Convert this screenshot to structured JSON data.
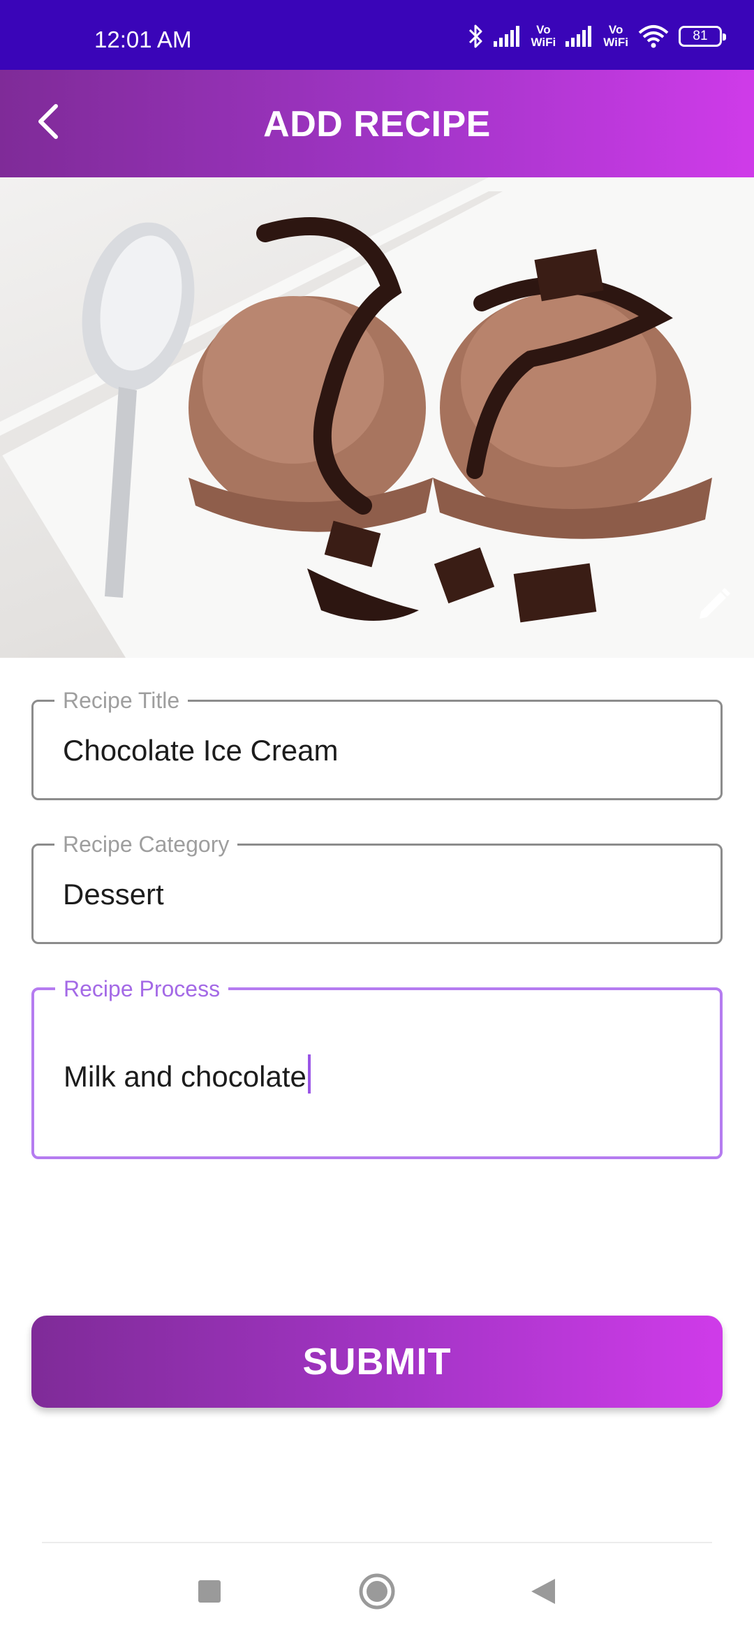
{
  "status_bar": {
    "time": "12:01 AM",
    "vowifi_1": "Vo WiFi",
    "vowifi_2": "Vo WiFi",
    "battery": "81"
  },
  "app_bar": {
    "title": "ADD RECIPE"
  },
  "form": {
    "title_label": "Recipe Title",
    "title_value": "Chocolate Ice Cream",
    "category_label": "Recipe Category",
    "category_value": "Dessert",
    "process_label": "Recipe Process",
    "process_value": "Milk and chocolate"
  },
  "submit": {
    "label": "SUBMIT"
  },
  "colors": {
    "status_bar": "#3a05b8",
    "gradient_start": "#7f2b98",
    "gradient_end": "#cf3be9",
    "focus_accent": "#b57cf0"
  },
  "icons": {
    "back": "arrow-back-icon",
    "edit": "pencil-icon",
    "recents": "square-icon",
    "home": "circle-icon",
    "back_nav": "triangle-back-icon"
  }
}
